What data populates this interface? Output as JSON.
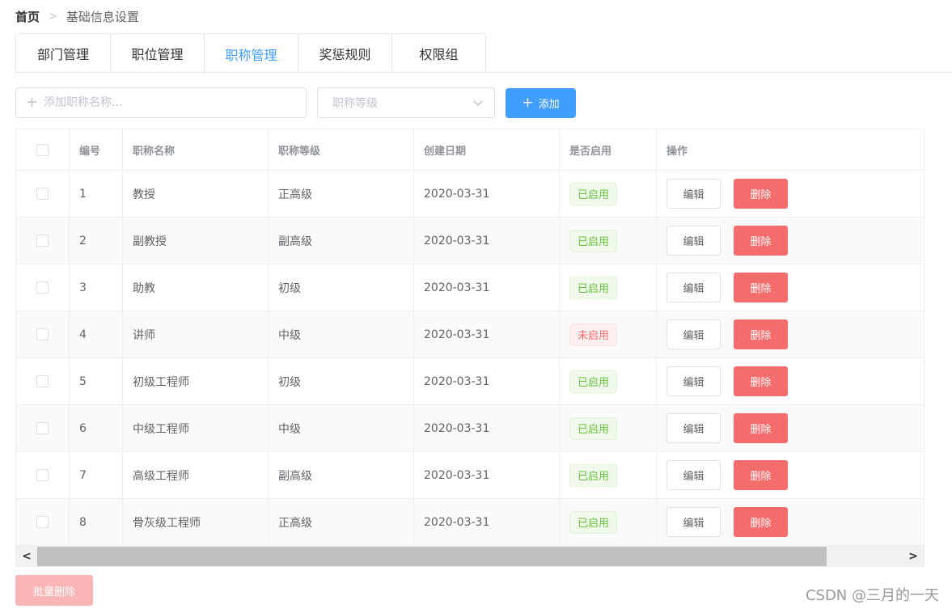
{
  "breadcrumb": {
    "home": "首页",
    "separator": ">",
    "current": "基础信息设置"
  },
  "tabs": [
    {
      "label": "部门管理",
      "active": false
    },
    {
      "label": "职位管理",
      "active": false
    },
    {
      "label": "职称管理",
      "active": true
    },
    {
      "label": "奖惩规则",
      "active": false
    },
    {
      "label": "权限组",
      "active": false
    }
  ],
  "toolbar": {
    "name_input_placeholder": "添加职称名称...",
    "name_input_value": "",
    "level_select_placeholder": "职称等级",
    "add_button_label": "添加",
    "plus_icon": "+"
  },
  "table": {
    "headers": {
      "id": "编号",
      "name": "职称名称",
      "level": "职称等级",
      "created": "创建日期",
      "enabled": "是否启用",
      "ops": "操作"
    },
    "edit_label": "编辑",
    "delete_label": "删除",
    "rows": [
      {
        "id": "1",
        "name": "教授",
        "level": "正高级",
        "created": "2020-03-31",
        "enabled": "已启用",
        "on": true
      },
      {
        "id": "2",
        "name": "副教授",
        "level": "副高级",
        "created": "2020-03-31",
        "enabled": "已启用",
        "on": true
      },
      {
        "id": "3",
        "name": "助教",
        "level": "初级",
        "created": "2020-03-31",
        "enabled": "已启用",
        "on": true
      },
      {
        "id": "4",
        "name": "讲师",
        "level": "中级",
        "created": "2020-03-31",
        "enabled": "未启用",
        "on": false
      },
      {
        "id": "5",
        "name": "初级工程师",
        "level": "初级",
        "created": "2020-03-31",
        "enabled": "已启用",
        "on": true
      },
      {
        "id": "6",
        "name": "中级工程师",
        "level": "中级",
        "created": "2020-03-31",
        "enabled": "已启用",
        "on": true
      },
      {
        "id": "7",
        "name": "高级工程师",
        "level": "副高级",
        "created": "2020-03-31",
        "enabled": "已启用",
        "on": true
      },
      {
        "id": "8",
        "name": "骨灰级工程师",
        "level": "正高级",
        "created": "2020-03-31",
        "enabled": "已启用",
        "on": true
      }
    ]
  },
  "scrollbar": {
    "left_arrow": "<",
    "right_arrow": ">"
  },
  "batch_delete_label": "批量删除",
  "watermark": "CSDN @三月的一天",
  "colors": {
    "primary": "#409eff",
    "danger": "#f56c6c",
    "success": "#67c23a",
    "batch_disabled": "#fab6b6"
  }
}
